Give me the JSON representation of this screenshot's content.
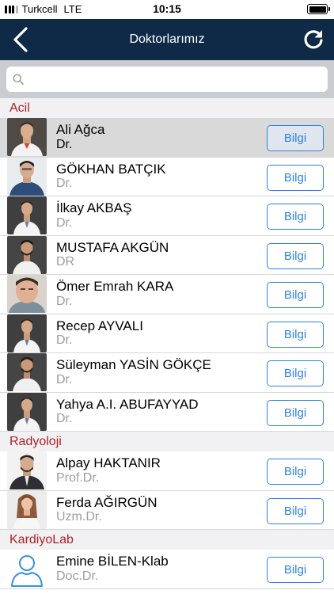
{
  "status_bar": {
    "carrier": "Turkcell",
    "network": "LTE",
    "time": "10:15"
  },
  "nav": {
    "title": "Doktorlarımız"
  },
  "search": {
    "placeholder": "",
    "value": ""
  },
  "sections": [
    {
      "name": "Acil",
      "doctors": [
        {
          "name": "Ali Ağca",
          "title": "Dr.",
          "button": "Bilgi",
          "selected": true,
          "photo": "a"
        },
        {
          "name": "GÖKHAN BATÇIK",
          "title": "Dr.",
          "button": "Bilgi",
          "photo": "b"
        },
        {
          "name": "İlkay AKBAŞ",
          "title": "Dr.",
          "button": "Bilgi",
          "photo": "c"
        },
        {
          "name": "MUSTAFA AKGÜN",
          "title": "DR",
          "button": "Bilgi",
          "photo": "d"
        },
        {
          "name": "Ömer Emrah KARA",
          "title": "Dr.",
          "button": "Bilgi",
          "photo": "e"
        },
        {
          "name": "Recep AYVALI",
          "title": "Dr.",
          "button": "Bilgi",
          "photo": "c"
        },
        {
          "name": "Süleyman YASİN GÖKÇE",
          "title": "Dr.",
          "button": "Bilgi",
          "photo": "d"
        },
        {
          "name": "Yahya A.I. ABUFAYYAD",
          "title": "Dr.",
          "button": "Bilgi",
          "photo": "c"
        }
      ]
    },
    {
      "name": "Radyoloji",
      "doctors": [
        {
          "name": "Alpay  HAKTANIR",
          "title": "Prof.Dr.",
          "button": "Bilgi",
          "photo": "f"
        },
        {
          "name": "Ferda AĞIRGÜN",
          "title": "Uzm.Dr.",
          "button": "Bilgi",
          "photo": "g"
        }
      ]
    },
    {
      "name": "KardiyoLab",
      "doctors": [
        {
          "name": "Emine BİLEN-Klab",
          "title": "Doc.Dr.",
          "button": "Bilgi",
          "photo": "none"
        }
      ]
    }
  ],
  "colors": {
    "nav_bg": "#0f2a47",
    "section_text": "#b21f24",
    "button": "#2c82e0"
  }
}
